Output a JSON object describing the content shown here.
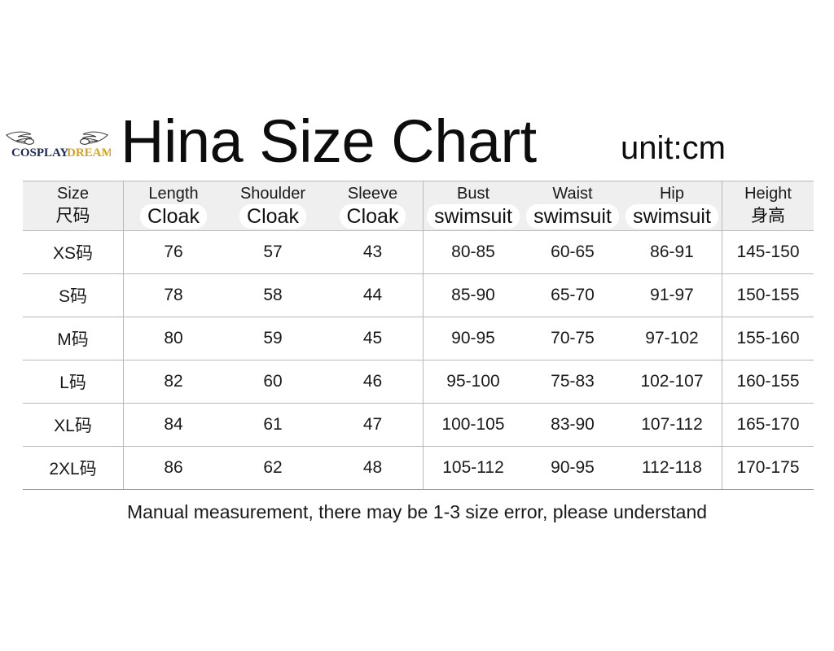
{
  "title": "Hina Size Chart",
  "unit": "unit:cm",
  "brand": {
    "part1": "COSPLAY",
    "part2": "DREAM",
    "part1_color": "#1b2a56",
    "part2_color": "#d9a021",
    "wing_color": "#3a3a3a"
  },
  "table": {
    "headers": [
      {
        "top": "Size",
        "bottom": "尺码",
        "bottom_style": "cjk"
      },
      {
        "top": "Length",
        "bottom": "Cloak",
        "bottom_style": "pill"
      },
      {
        "top": "Shoulder",
        "bottom": "Cloak",
        "bottom_style": "pill"
      },
      {
        "top": "Sleeve",
        "bottom": "Cloak",
        "bottom_style": "pill"
      },
      {
        "top": "Bust",
        "bottom": "swimsuit",
        "bottom_style": "pill"
      },
      {
        "top": "Waist",
        "bottom": "swimsuit",
        "bottom_style": "pill"
      },
      {
        "top": "Hip",
        "bottom": "swimsuit",
        "bottom_style": "pill"
      },
      {
        "top": "Height",
        "bottom": "身高",
        "bottom_style": "cjk"
      }
    ],
    "rows": [
      {
        "size": "XS码",
        "length": "76",
        "shoulder": "57",
        "sleeve": "43",
        "bust": "80-85",
        "waist": "60-65",
        "hip": "86-91",
        "height": "145-150"
      },
      {
        "size": "S码",
        "length": "78",
        "shoulder": "58",
        "sleeve": "44",
        "bust": "85-90",
        "waist": "65-70",
        "hip": "91-97",
        "height": "150-155"
      },
      {
        "size": "M码",
        "length": "80",
        "shoulder": "59",
        "sleeve": "45",
        "bust": "90-95",
        "waist": "70-75",
        "hip": "97-102",
        "height": "155-160"
      },
      {
        "size": "L码",
        "length": "82",
        "shoulder": "60",
        "sleeve": "46",
        "bust": "95-100",
        "waist": "75-83",
        "hip": "102-107",
        "height": "160-155"
      },
      {
        "size": "XL码",
        "length": "84",
        "shoulder": "61",
        "sleeve": "47",
        "bust": "100-105",
        "waist": "83-90",
        "hip": "107-112",
        "height": "165-170"
      },
      {
        "size": "2XL码",
        "length": "86",
        "shoulder": "62",
        "sleeve": "48",
        "bust": "105-112",
        "waist": "90-95",
        "hip": "112-118",
        "height": "170-175"
      }
    ]
  },
  "footer_note": "Manual measurement, there may be 1-3 size error, please understand",
  "colors": {
    "header_background": "#efefef",
    "border": "#b9b9b9",
    "text": "#1a1a1a",
    "page_background": "#ffffff"
  }
}
